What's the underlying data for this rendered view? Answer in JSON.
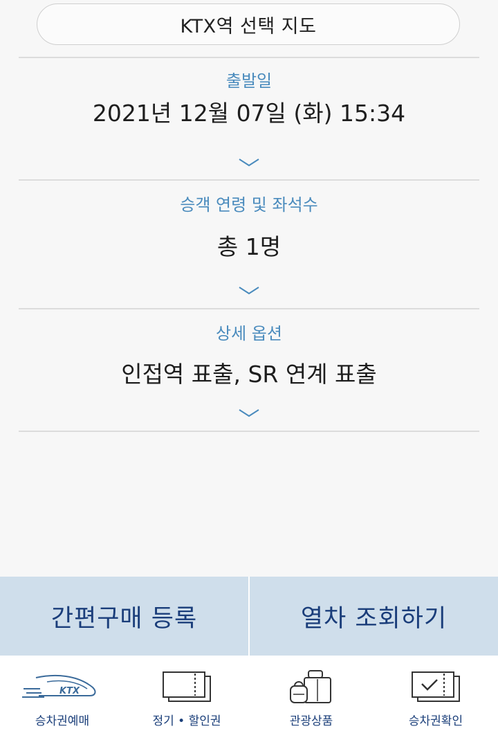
{
  "map_button": {
    "label": "KTX역 선택 지도"
  },
  "departure": {
    "label": "출발일",
    "value": "2021년 12월 07일 (화) 15:34"
  },
  "passengers": {
    "label": "승객 연령 및 좌석수",
    "value": "총 1명"
  },
  "options": {
    "label": "상세 옵션",
    "value": "인접역 표출, SR 연계 표출"
  },
  "actions": {
    "quick_purchase": "간편구매 등록",
    "search_train": "열차 조회하기"
  },
  "tabs": [
    {
      "label": "승차권예매",
      "icon": "ktx-train-icon"
    },
    {
      "label": "정기 • 할인권",
      "icon": "ticket-icon"
    },
    {
      "label": "관광상품",
      "icon": "luggage-icon"
    },
    {
      "label": "승차권확인",
      "icon": "ticket-check-icon"
    }
  ],
  "colors": {
    "label_blue": "#4a8bbd",
    "action_bar_bg": "#cfdeeb",
    "action_text": "#1a3d7a",
    "tab_text": "#1b3f7a"
  },
  "logo_text": "KTX"
}
